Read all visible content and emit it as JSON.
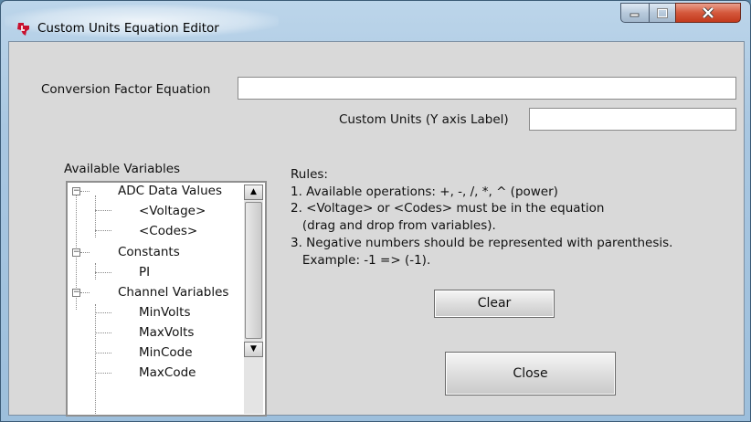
{
  "window": {
    "title": "Custom Units Equation Editor"
  },
  "title_buttons": {
    "minimize": "minimize-icon",
    "maximize": "maximize-icon",
    "close": "close-icon"
  },
  "form": {
    "conversion_label": "Conversion Factor Equation",
    "conversion_value": "",
    "units_label": "Custom Units (Y axis Label)",
    "units_value": ""
  },
  "variables": {
    "label": "Available Variables",
    "items": [
      {
        "text": "ADC Data Values",
        "level": 0,
        "expander": "⊟"
      },
      {
        "text": "<Voltage>",
        "level": 1
      },
      {
        "text": "<Codes>",
        "level": 1
      },
      {
        "text": "Constants",
        "level": 0,
        "expander": "⊟"
      },
      {
        "text": "PI",
        "level": 1
      },
      {
        "text": "Channel Variables",
        "level": 0,
        "expander": "⊟"
      },
      {
        "text": "MinVolts",
        "level": 1
      },
      {
        "text": "MaxVolts",
        "level": 1
      },
      {
        "text": "MinCode",
        "level": 1
      },
      {
        "text": "MaxCode",
        "level": 1
      }
    ],
    "scroll_up": "▲",
    "scroll_down": "▼"
  },
  "rules": {
    "title": "Rules:",
    "lines": [
      "1. Available operations: +, -, /, *, ^ (power)",
      "2. <Voltage> or <Codes> must be in the equation",
      "   (drag and drop from variables).",
      "3. Negative numbers should be represented with parenthesis.",
      "   Example: -1 => (-1)."
    ]
  },
  "buttons": {
    "clear": "Clear",
    "close": "Close"
  },
  "colors": {
    "desktop": "#5b86a6",
    "client_bg": "#d9d9d9",
    "close_button": "#c3391c"
  }
}
